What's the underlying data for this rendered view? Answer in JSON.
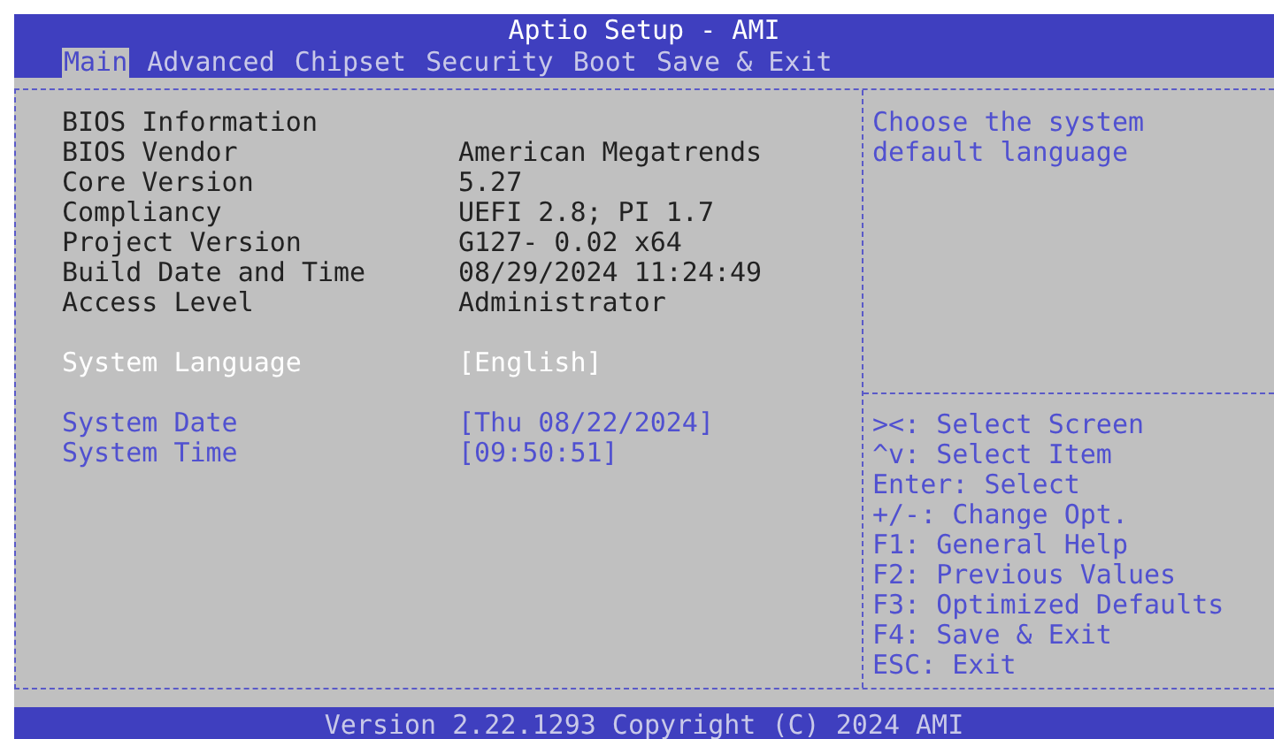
{
  "window": {
    "title": "Aptio Setup - AMI"
  },
  "tabs": [
    {
      "label": "Main",
      "selected": true
    },
    {
      "label": "Advanced",
      "selected": false
    },
    {
      "label": "Chipset",
      "selected": false
    },
    {
      "label": "Security",
      "selected": false
    },
    {
      "label": "Boot",
      "selected": false
    },
    {
      "label": "Save & Exit",
      "selected": false
    }
  ],
  "info": {
    "heading": "BIOS Information",
    "rows": [
      {
        "label": "BIOS Vendor",
        "value": "American Megatrends"
      },
      {
        "label": "Core Version",
        "value": "5.27"
      },
      {
        "label": "Compliancy",
        "value": "UEFI 2.8; PI 1.7"
      },
      {
        "label": "Project Version",
        "value": "G127- 0.02 x64"
      },
      {
        "label": "Build Date and Time",
        "value": "08/29/2024 11:24:49"
      },
      {
        "label": "Access Level",
        "value": "Administrator"
      }
    ]
  },
  "setting_groups": [
    [
      {
        "label": "System Language",
        "value": "[English]",
        "selected": true
      }
    ],
    [
      {
        "label": "System Date",
        "value": "[Thu 08/22/2024]",
        "selected": false
      },
      {
        "label": "System Time",
        "value": "[09:50:51]",
        "selected": false
      }
    ]
  ],
  "help": {
    "lines": [
      "Choose the system",
      "default language"
    ]
  },
  "keys": [
    "><: Select Screen",
    "^v: Select Item",
    "Enter: Select",
    "+/-: Change Opt.",
    "F1: General Help",
    "F2: Previous Values",
    "F3: Optimized Defaults",
    "F4: Save & Exit",
    "ESC: Exit"
  ],
  "status_bar": "Version 2.22.1293 Copyright (C) 2024 AMI"
}
